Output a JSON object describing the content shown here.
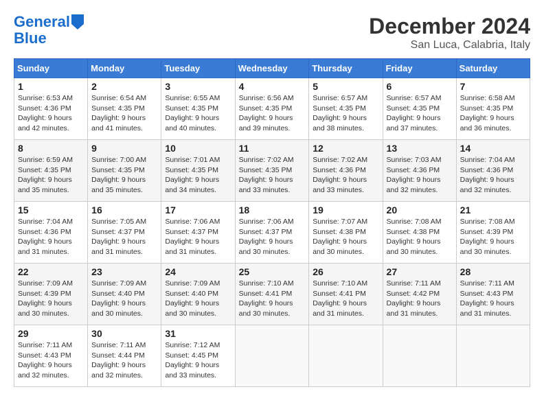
{
  "logo": {
    "line1": "General",
    "line2": "Blue"
  },
  "title": "December 2024",
  "location": "San Luca, Calabria, Italy",
  "days_of_week": [
    "Sunday",
    "Monday",
    "Tuesday",
    "Wednesday",
    "Thursday",
    "Friday",
    "Saturday"
  ],
  "weeks": [
    [
      {
        "day": "1",
        "info": "Sunrise: 6:53 AM\nSunset: 4:36 PM\nDaylight: 9 hours\nand 42 minutes."
      },
      {
        "day": "2",
        "info": "Sunrise: 6:54 AM\nSunset: 4:35 PM\nDaylight: 9 hours\nand 41 minutes."
      },
      {
        "day": "3",
        "info": "Sunrise: 6:55 AM\nSunset: 4:35 PM\nDaylight: 9 hours\nand 40 minutes."
      },
      {
        "day": "4",
        "info": "Sunrise: 6:56 AM\nSunset: 4:35 PM\nDaylight: 9 hours\nand 39 minutes."
      },
      {
        "day": "5",
        "info": "Sunrise: 6:57 AM\nSunset: 4:35 PM\nDaylight: 9 hours\nand 38 minutes."
      },
      {
        "day": "6",
        "info": "Sunrise: 6:57 AM\nSunset: 4:35 PM\nDaylight: 9 hours\nand 37 minutes."
      },
      {
        "day": "7",
        "info": "Sunrise: 6:58 AM\nSunset: 4:35 PM\nDaylight: 9 hours\nand 36 minutes."
      }
    ],
    [
      {
        "day": "8",
        "info": "Sunrise: 6:59 AM\nSunset: 4:35 PM\nDaylight: 9 hours\nand 35 minutes."
      },
      {
        "day": "9",
        "info": "Sunrise: 7:00 AM\nSunset: 4:35 PM\nDaylight: 9 hours\nand 35 minutes."
      },
      {
        "day": "10",
        "info": "Sunrise: 7:01 AM\nSunset: 4:35 PM\nDaylight: 9 hours\nand 34 minutes."
      },
      {
        "day": "11",
        "info": "Sunrise: 7:02 AM\nSunset: 4:35 PM\nDaylight: 9 hours\nand 33 minutes."
      },
      {
        "day": "12",
        "info": "Sunrise: 7:02 AM\nSunset: 4:36 PM\nDaylight: 9 hours\nand 33 minutes."
      },
      {
        "day": "13",
        "info": "Sunrise: 7:03 AM\nSunset: 4:36 PM\nDaylight: 9 hours\nand 32 minutes."
      },
      {
        "day": "14",
        "info": "Sunrise: 7:04 AM\nSunset: 4:36 PM\nDaylight: 9 hours\nand 32 minutes."
      }
    ],
    [
      {
        "day": "15",
        "info": "Sunrise: 7:04 AM\nSunset: 4:36 PM\nDaylight: 9 hours\nand 31 minutes."
      },
      {
        "day": "16",
        "info": "Sunrise: 7:05 AM\nSunset: 4:37 PM\nDaylight: 9 hours\nand 31 minutes."
      },
      {
        "day": "17",
        "info": "Sunrise: 7:06 AM\nSunset: 4:37 PM\nDaylight: 9 hours\nand 31 minutes."
      },
      {
        "day": "18",
        "info": "Sunrise: 7:06 AM\nSunset: 4:37 PM\nDaylight: 9 hours\nand 30 minutes."
      },
      {
        "day": "19",
        "info": "Sunrise: 7:07 AM\nSunset: 4:38 PM\nDaylight: 9 hours\nand 30 minutes."
      },
      {
        "day": "20",
        "info": "Sunrise: 7:08 AM\nSunset: 4:38 PM\nDaylight: 9 hours\nand 30 minutes."
      },
      {
        "day": "21",
        "info": "Sunrise: 7:08 AM\nSunset: 4:39 PM\nDaylight: 9 hours\nand 30 minutes."
      }
    ],
    [
      {
        "day": "22",
        "info": "Sunrise: 7:09 AM\nSunset: 4:39 PM\nDaylight: 9 hours\nand 30 minutes."
      },
      {
        "day": "23",
        "info": "Sunrise: 7:09 AM\nSunset: 4:40 PM\nDaylight: 9 hours\nand 30 minutes."
      },
      {
        "day": "24",
        "info": "Sunrise: 7:09 AM\nSunset: 4:40 PM\nDaylight: 9 hours\nand 30 minutes."
      },
      {
        "day": "25",
        "info": "Sunrise: 7:10 AM\nSunset: 4:41 PM\nDaylight: 9 hours\nand 30 minutes."
      },
      {
        "day": "26",
        "info": "Sunrise: 7:10 AM\nSunset: 4:41 PM\nDaylight: 9 hours\nand 31 minutes."
      },
      {
        "day": "27",
        "info": "Sunrise: 7:11 AM\nSunset: 4:42 PM\nDaylight: 9 hours\nand 31 minutes."
      },
      {
        "day": "28",
        "info": "Sunrise: 7:11 AM\nSunset: 4:43 PM\nDaylight: 9 hours\nand 31 minutes."
      }
    ],
    [
      {
        "day": "29",
        "info": "Sunrise: 7:11 AM\nSunset: 4:43 PM\nDaylight: 9 hours\nand 32 minutes."
      },
      {
        "day": "30",
        "info": "Sunrise: 7:11 AM\nSunset: 4:44 PM\nDaylight: 9 hours\nand 32 minutes."
      },
      {
        "day": "31",
        "info": "Sunrise: 7:12 AM\nSunset: 4:45 PM\nDaylight: 9 hours\nand 33 minutes."
      },
      {
        "day": "",
        "info": ""
      },
      {
        "day": "",
        "info": ""
      },
      {
        "day": "",
        "info": ""
      },
      {
        "day": "",
        "info": ""
      }
    ]
  ]
}
